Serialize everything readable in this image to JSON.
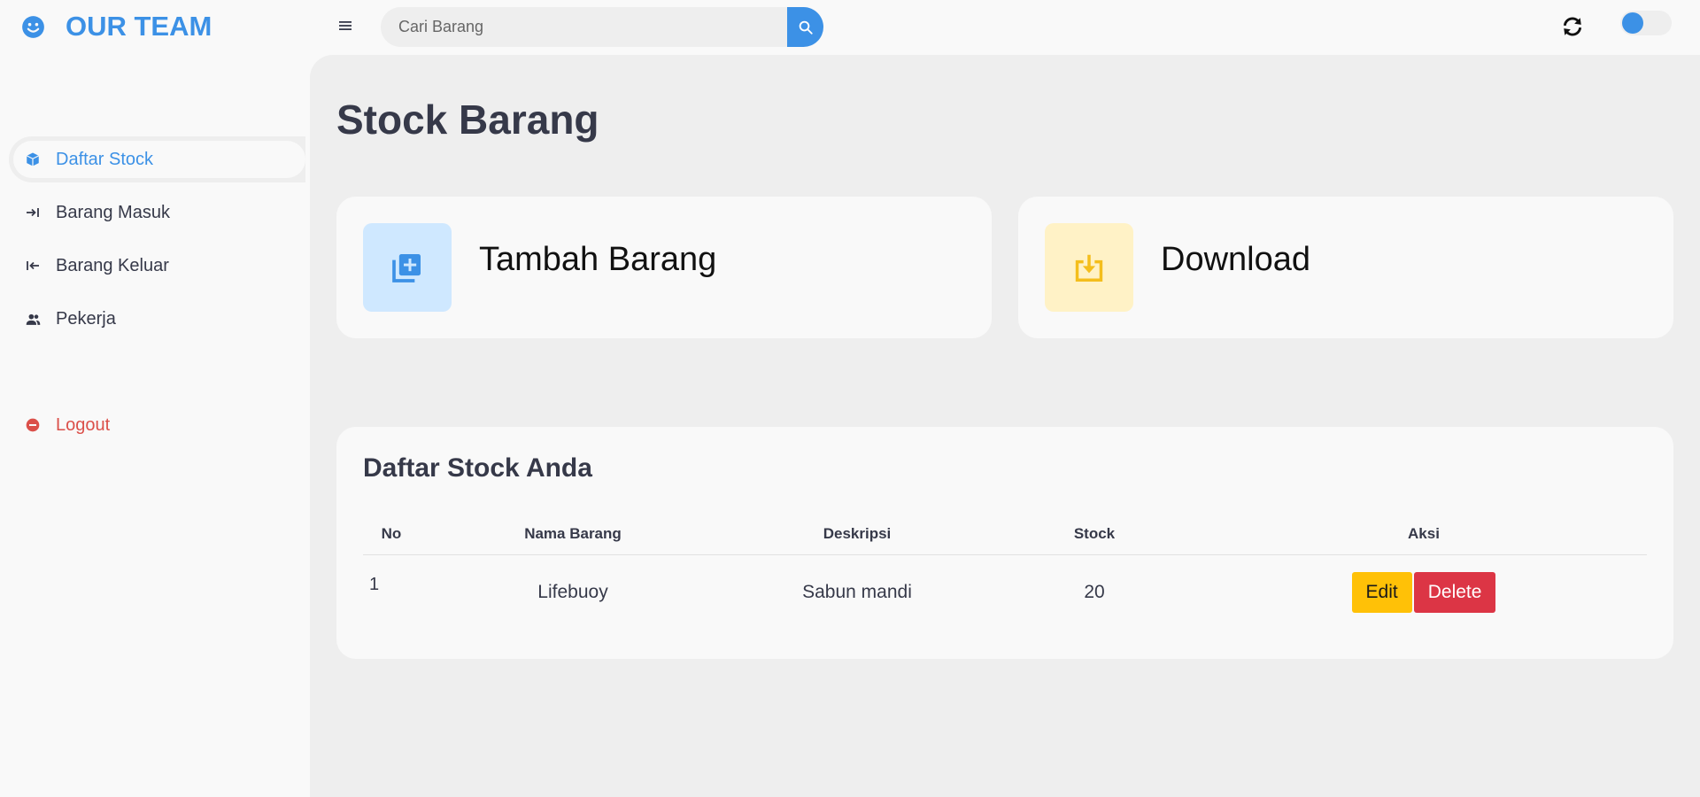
{
  "brand": {
    "name": "OUR TEAM",
    "accent": "#3c91e6"
  },
  "search": {
    "placeholder": "Cari Barang"
  },
  "sidebar": {
    "items": [
      {
        "label": "Daftar Stock",
        "icon": "box-icon",
        "active": true
      },
      {
        "label": "Barang Masuk",
        "icon": "arrow-in-icon"
      },
      {
        "label": "Barang Keluar",
        "icon": "arrow-out-icon"
      },
      {
        "label": "Pekerja",
        "icon": "users-icon"
      }
    ],
    "logout": {
      "label": "Logout",
      "icon": "logout-icon",
      "color": "#db504a"
    }
  },
  "main": {
    "title": "Stock Barang",
    "cards": {
      "add": {
        "label": "Tambah Barang",
        "icon": "add-item-icon",
        "tile_color": "#cfe8ff"
      },
      "download": {
        "label": "Download",
        "icon": "download-icon",
        "tile_color": "#fff2c6"
      }
    },
    "table": {
      "title": "Daftar Stock Anda",
      "headers": {
        "no": "No",
        "name": "Nama Barang",
        "desc": "Deskripsi",
        "stock": "Stock",
        "action": "Aksi"
      },
      "rows": [
        {
          "no": "1",
          "name": "Lifebuoy",
          "desc": "Sabun mandi",
          "stock": "20",
          "edit": "Edit",
          "delete": "Delete"
        }
      ]
    }
  }
}
